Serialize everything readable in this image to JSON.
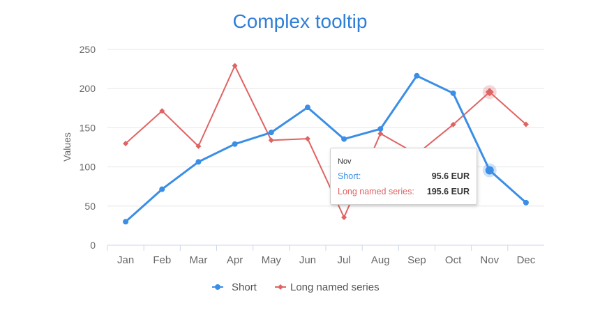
{
  "chart_data": {
    "type": "line",
    "title": "Complex tooltip",
    "ylabel": "Values",
    "xlabel": "",
    "ylim": [
      0,
      250
    ],
    "yticks": [
      0,
      50,
      100,
      150,
      200,
      250
    ],
    "grid": true,
    "legend_position": "bottom-center",
    "categories": [
      "Jan",
      "Feb",
      "Mar",
      "Apr",
      "May",
      "Jun",
      "Jul",
      "Aug",
      "Sep",
      "Oct",
      "Nov",
      "Dec"
    ],
    "series": [
      {
        "name": "Short",
        "color": "#3a8ee6",
        "marker": "circle",
        "values": [
          30,
          71.5,
          106.4,
          129.2,
          144.0,
          176.0,
          135.6,
          148.5,
          216.4,
          194.1,
          95.6,
          54.4
        ]
      },
      {
        "name": "Long named series",
        "color": "#e06363",
        "marker": "diamond",
        "values": [
          129.9,
          171.5,
          126.4,
          229.2,
          134.0,
          136.0,
          35.6,
          142.5,
          116.4,
          154.1,
          195.6,
          154.4
        ]
      }
    ],
    "tooltip": {
      "category": "Nov",
      "rows": [
        {
          "series": "Short:",
          "value": "95.6 EUR"
        },
        {
          "series": "Long named series:",
          "value": "195.6 EUR"
        }
      ]
    }
  }
}
